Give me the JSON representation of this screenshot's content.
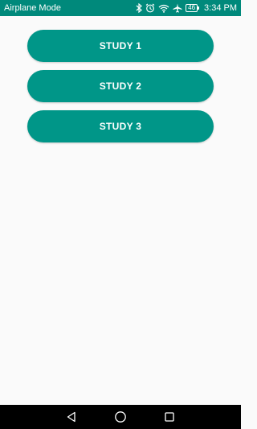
{
  "status_bar": {
    "mode_text": "Airplane Mode",
    "battery_level": "46",
    "time": "3:34 PM",
    "icons": [
      "bluetooth-icon",
      "alarm-icon",
      "wifi-icon",
      "airplane-icon",
      "battery-icon"
    ]
  },
  "main": {
    "buttons": [
      {
        "label": "STUDY 1"
      },
      {
        "label": "STUDY 2"
      },
      {
        "label": "STUDY 3"
      }
    ]
  },
  "nav_bar": {
    "icons": [
      "back-icon",
      "home-icon",
      "recents-icon"
    ]
  },
  "colors": {
    "status_bar": "#00897b",
    "button": "#009688",
    "background": "#fafafa",
    "nav_bar": "#000000"
  }
}
